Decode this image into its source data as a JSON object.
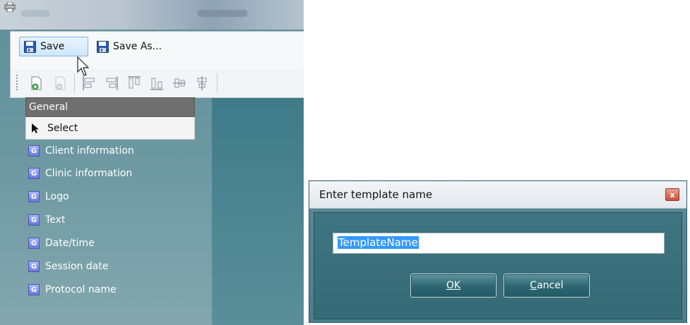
{
  "menu": {
    "save_label": "Save",
    "save_as_label": "Save As..."
  },
  "toolbar": {
    "icons": [
      "new-page-icon",
      "remove-page-icon",
      "align-left-icon",
      "align-right-icon",
      "align-top-icon",
      "align-bottom-icon",
      "center-horizontal-icon",
      "center-vertical-icon"
    ]
  },
  "general": {
    "header": "General",
    "select_label": "Select",
    "items": [
      "Client information",
      "Clinic information",
      "Logo",
      "Text",
      "Date/time",
      "Session date",
      "Protocol name"
    ],
    "badge": "G"
  },
  "dialog": {
    "title": "Enter template name",
    "close_label": "x",
    "input_value": "TemplateName",
    "ok_label": "OK",
    "cancel_label": "Cancel",
    "cancel_underline": "C",
    "cancel_rest": "ancel"
  },
  "colors": {
    "panel_teal": "#5d8e99",
    "dialog_teal": "#356b77",
    "selection_blue": "#3399ff",
    "badge_blue": "#6b78d8"
  }
}
